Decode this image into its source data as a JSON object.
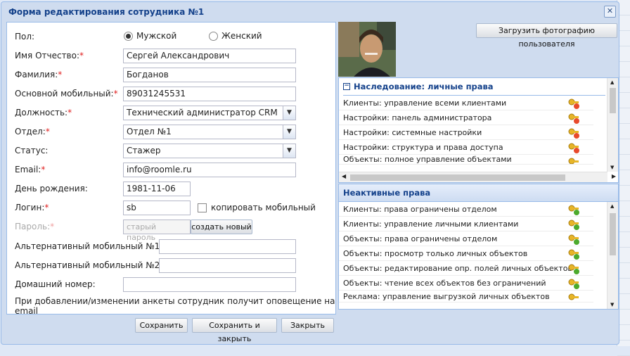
{
  "window": {
    "title": "Форма редактирования сотрудника №1"
  },
  "form": {
    "gender": {
      "label": "Пол:",
      "male": "Мужской",
      "female": "Женский",
      "selected": "male"
    },
    "first_middle_name": {
      "label": "Имя Отчество:",
      "req": "*",
      "value": "Сергей Александрович"
    },
    "last_name": {
      "label": "Фамилия:",
      "req": "*",
      "value": "Богданов"
    },
    "mobile": {
      "label": "Основной мобильный:",
      "req": "*",
      "value": "89031245531"
    },
    "position": {
      "label": "Должность:",
      "req": "*",
      "value": "Технический администратор CRM"
    },
    "department": {
      "label": "Отдел:",
      "req": "*",
      "value": "Отдел №1"
    },
    "status": {
      "label": "Статус:",
      "value": "Стажер"
    },
    "email": {
      "label": "Email:",
      "req": "*",
      "value": "info@roomle.ru"
    },
    "birthday": {
      "label": "День рождения:",
      "value": "1981-11-06"
    },
    "login": {
      "label": "Логин:",
      "req": "*",
      "value": "sb",
      "copy_label": "копировать мобильный"
    },
    "password": {
      "label": "Пароль:",
      "req": "*",
      "placeholder": "старый пароль",
      "create_btn": "создать новый"
    },
    "alt_mobile1": {
      "label": "Альтернативный мобильный №1:",
      "value": ""
    },
    "alt_mobile2": {
      "label": "Альтернативный мобильный №2:",
      "value": ""
    },
    "home_phone": {
      "label": "Домашний номер:",
      "value": ""
    },
    "notice": "При добавлении/изменении анкеты сотрудник получит оповещение на email"
  },
  "buttons": {
    "save": "Сохранить",
    "save_close": "Сохранить и закрыть",
    "close": "Закрыть"
  },
  "photo": {
    "upload_btn": "Загрузить фотографию пользователя"
  },
  "inherited": {
    "title": "Наследование: личные права",
    "items": [
      "Клиенты: управление всеми клиентами",
      "Настройки: панель администратора",
      "Настройки: системные настройки",
      "Настройки: структура и права доступа",
      "Объекты: полное управление объектами"
    ]
  },
  "inactive": {
    "title": "Неактивные права",
    "items": [
      "Клиенты: права ограничены отделом",
      "Клиенты: управление личными клиентами",
      "Объекты: права ограничены отделом",
      "Объекты: просмотр только личных объектов",
      "Объекты: редактирование опр. полей личных объектов",
      "Объекты: чтение всех объектов без ограничений",
      "Реклама: управление выгрузкой личных объектов"
    ]
  }
}
